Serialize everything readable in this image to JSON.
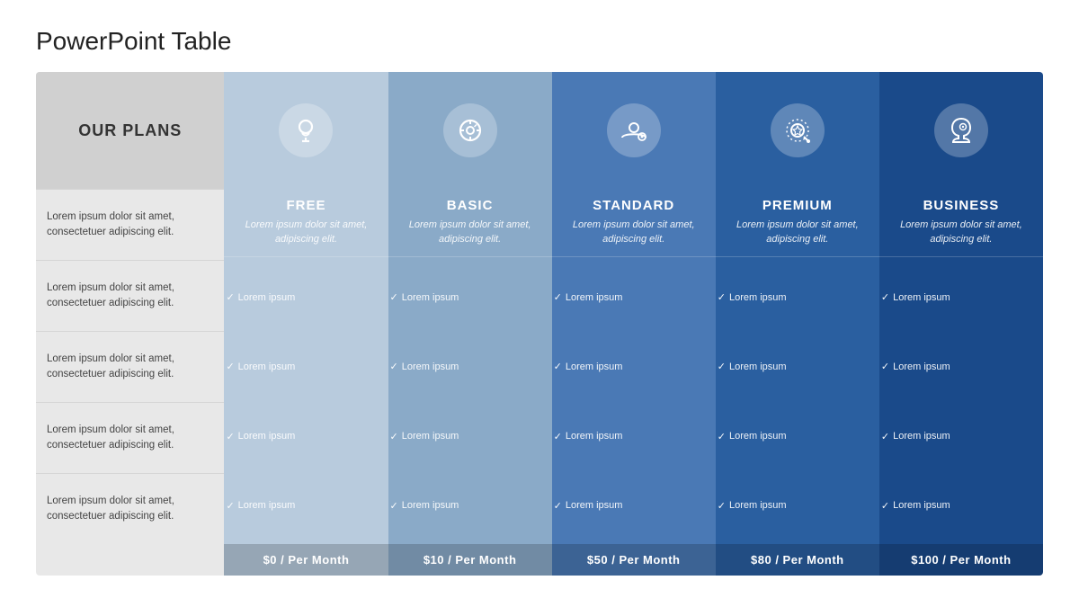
{
  "page": {
    "title": "PowerPoint Table"
  },
  "plans_label": "OUR PLANS",
  "left_rows": [
    "Lorem ipsum dolor sit amet, consectetuer adipiscing elit.",
    "Lorem ipsum dolor sit amet, consectetuer adipiscing elit.",
    "Lorem ipsum dolor sit amet, consectetuer adipiscing elit.",
    "Lorem ipsum dolor sit amet, consectetuer adipiscing elit.",
    "Lorem ipsum dolor sit amet, consectetuer adipiscing elit."
  ],
  "columns": [
    {
      "id": "free",
      "icon": "💡",
      "name": "FREE",
      "desc": "Lorem ipsum dolor sit amet, adipiscing elit.",
      "features": [
        "Lorem ipsum",
        "Lorem ipsum",
        "Lorem ipsum",
        "Lorem ipsum"
      ],
      "price": "$0 / Per Month",
      "color_class": "col-free"
    },
    {
      "id": "basic",
      "icon": "🎯",
      "name": "BASIC",
      "desc": "Lorem ipsum dolor sit amet, adipiscing elit.",
      "features": [
        "Lorem ipsum",
        "Lorem ipsum",
        "Lorem ipsum",
        "Lorem ipsum"
      ],
      "price": "$10 / Per Month",
      "color_class": "col-basic"
    },
    {
      "id": "standard",
      "icon": "⚙",
      "name": "STANDARD",
      "desc": "Lorem ipsum dolor sit amet, adipiscing elit.",
      "features": [
        "Lorem ipsum",
        "Lorem ipsum",
        "Lorem ipsum",
        "Lorem ipsum"
      ],
      "price": "$50 / Per Month",
      "color_class": "col-standard"
    },
    {
      "id": "premium",
      "icon": "🔍",
      "name": "PREMIUM",
      "desc": "Lorem ipsum dolor sit amet, adipiscing elit.",
      "features": [
        "Lorem ipsum",
        "Lorem ipsum",
        "Lorem ipsum",
        "Lorem ipsum"
      ],
      "price": "$80 / Per Month",
      "color_class": "col-premium"
    },
    {
      "id": "business",
      "icon": "🧠",
      "name": "BUSINESS",
      "desc": "Lorem ipsum dolor sit amet, adipiscing elit.",
      "features": [
        "Lorem ipsum",
        "Lorem ipsum",
        "Lorem ipsum",
        "Lorem ipsum"
      ],
      "price": "$100 / Per Month",
      "color_class": "col-business"
    }
  ]
}
